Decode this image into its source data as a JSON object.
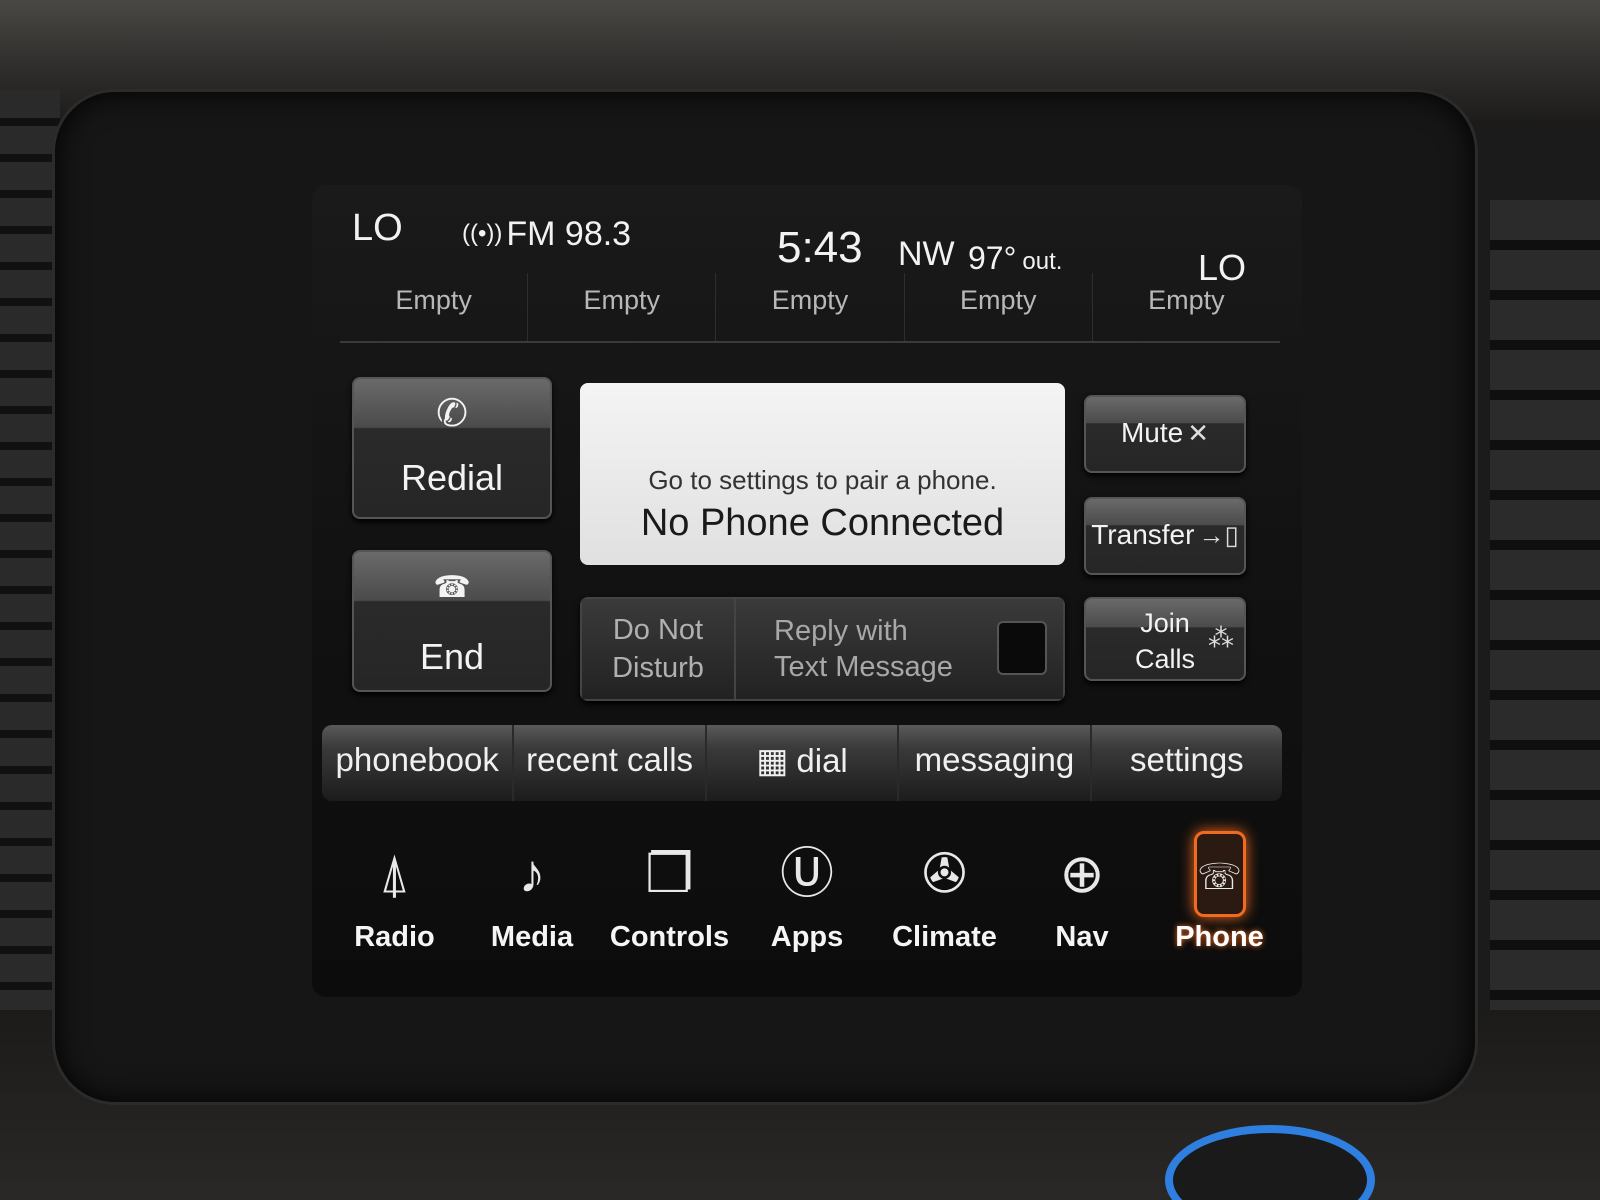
{
  "status": {
    "left_temp": "LO",
    "radio": "FM 98.3",
    "time": "5:43",
    "heading": "NW",
    "outside_temp": "97°",
    "outside_label": "out.",
    "right_temp": "LO"
  },
  "favorites": [
    "Empty",
    "Empty",
    "Empty",
    "Empty",
    "Empty"
  ],
  "call_controls": {
    "redial": "Redial",
    "end": "End",
    "mute": "Mute",
    "transfer": "Transfer",
    "join_line1": "Join",
    "join_line2": "Calls"
  },
  "message": {
    "hint": "Go to settings to pair a phone.",
    "title": "No Phone Connected"
  },
  "options": {
    "dnd_line1": "Do Not",
    "dnd_line2": "Disturb",
    "reply_line1": "Reply with",
    "reply_line2": "Text Message"
  },
  "phone_tabs": [
    "phonebook",
    "recent calls",
    "dial",
    "messaging",
    "settings"
  ],
  "apps": [
    "Radio",
    "Media",
    "Controls",
    "Apps",
    "Climate",
    "Nav",
    "Phone"
  ],
  "active_app": "Phone",
  "colors": {
    "active_glow": "#f06a20",
    "knob_ring": "#2f7fe0"
  },
  "icons": {
    "radio": "radio-tower-icon",
    "media": "media-phone-icon",
    "controls": "seat-controls-icon",
    "apps": "uconnect-apps-icon",
    "climate": "climate-fan-icon",
    "nav": "compass-icon",
    "phone": "phone-icon"
  }
}
